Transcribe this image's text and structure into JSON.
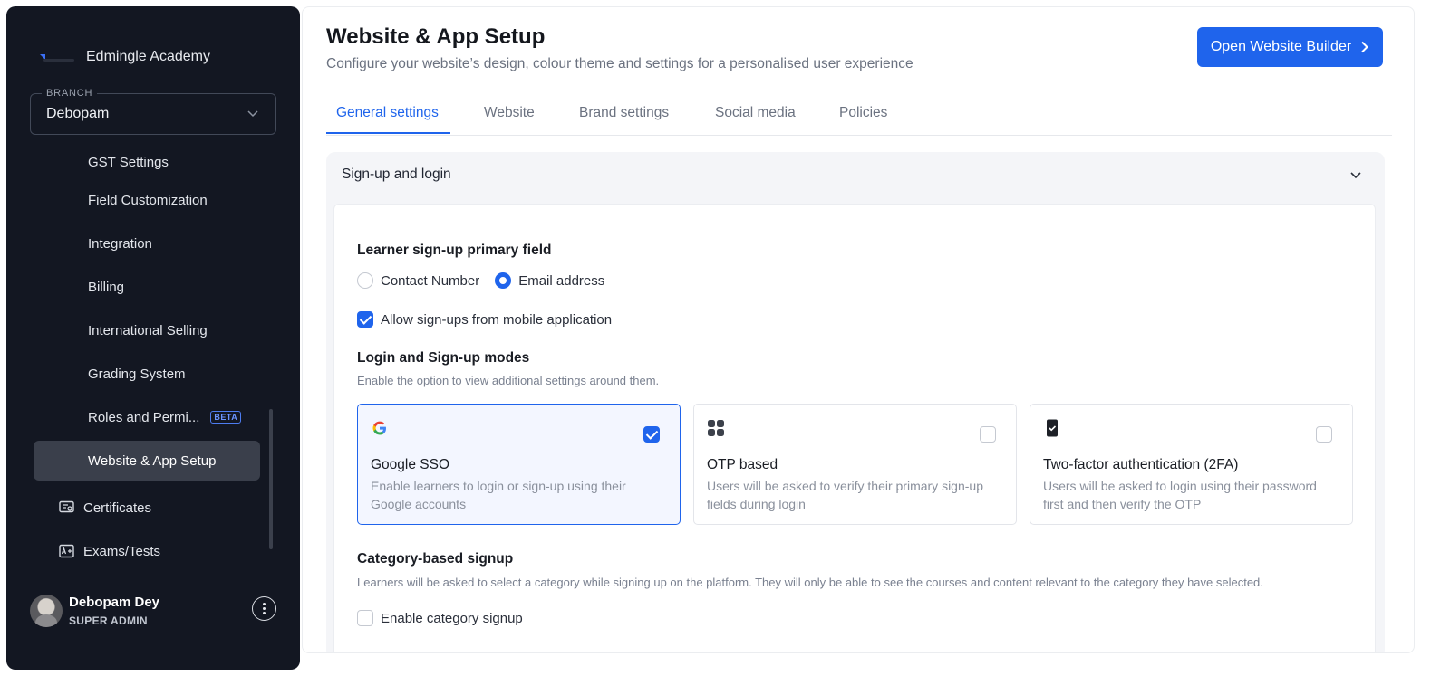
{
  "sidebar": {
    "brand_name": "Edmingle Academy",
    "branch": {
      "label": "BRANCH",
      "value": "Debopam"
    },
    "items": [
      {
        "label": "GST Settings"
      },
      {
        "label": "Field Customization"
      },
      {
        "label": "Integration"
      },
      {
        "label": "Billing"
      },
      {
        "label": "International Selling"
      },
      {
        "label": "Grading System"
      },
      {
        "label": "Roles and Permi...",
        "badge": "BETA"
      },
      {
        "label": "Website & App Setup",
        "active": true
      },
      {
        "label": "Certificates",
        "icon": "certificate-icon"
      },
      {
        "label": "Exams/Tests",
        "icon": "exam-icon"
      }
    ],
    "profile": {
      "name": "Debopam Dey",
      "role": "SUPER ADMIN"
    }
  },
  "header": {
    "title": "Website & App Setup",
    "subtitle": "Configure your website’s design, colour theme and settings for a personalised user experience",
    "cta_label": "Open Website Builder"
  },
  "tabs": [
    {
      "label": "General settings",
      "active": true
    },
    {
      "label": "Website"
    },
    {
      "label": "Brand settings"
    },
    {
      "label": "Social media"
    },
    {
      "label": "Policies"
    }
  ],
  "accordion": {
    "title": "Sign-up and login",
    "primary_field": {
      "title": "Learner sign-up primary field",
      "options": [
        {
          "label": "Contact Number",
          "selected": false
        },
        {
          "label": "Email address",
          "selected": true
        }
      ]
    },
    "mobile_signup": {
      "label": "Allow sign-ups from mobile application",
      "checked": true
    },
    "modes": {
      "title": "Login and Sign-up modes",
      "description": "Enable the option to view additional settings around them.",
      "cards": [
        {
          "icon": "google-icon",
          "title": "Google SSO",
          "description": "Enable learners to login or sign-up using their Google accounts",
          "checked": true
        },
        {
          "icon": "grid-icon",
          "title": "OTP based",
          "description": "Users will be asked to verify their primary sign-up fields during login",
          "checked": false
        },
        {
          "icon": "phone-lock-icon",
          "title": "Two-factor authentication (2FA)",
          "description": "Users will be asked to login using their password first and then verify the OTP",
          "checked": false
        }
      ]
    },
    "category_signup": {
      "title": "Category-based signup",
      "description": "Learners will be asked to select a category while signing up on the platform. They will only be able to see the courses and content relevant to the category they have selected.",
      "checkbox_label": "Enable category signup",
      "checked": false
    }
  },
  "colors": {
    "accent": "#1f64ec",
    "sidebar_bg": "#131722",
    "active_item_bg": "#3a3f4b"
  }
}
